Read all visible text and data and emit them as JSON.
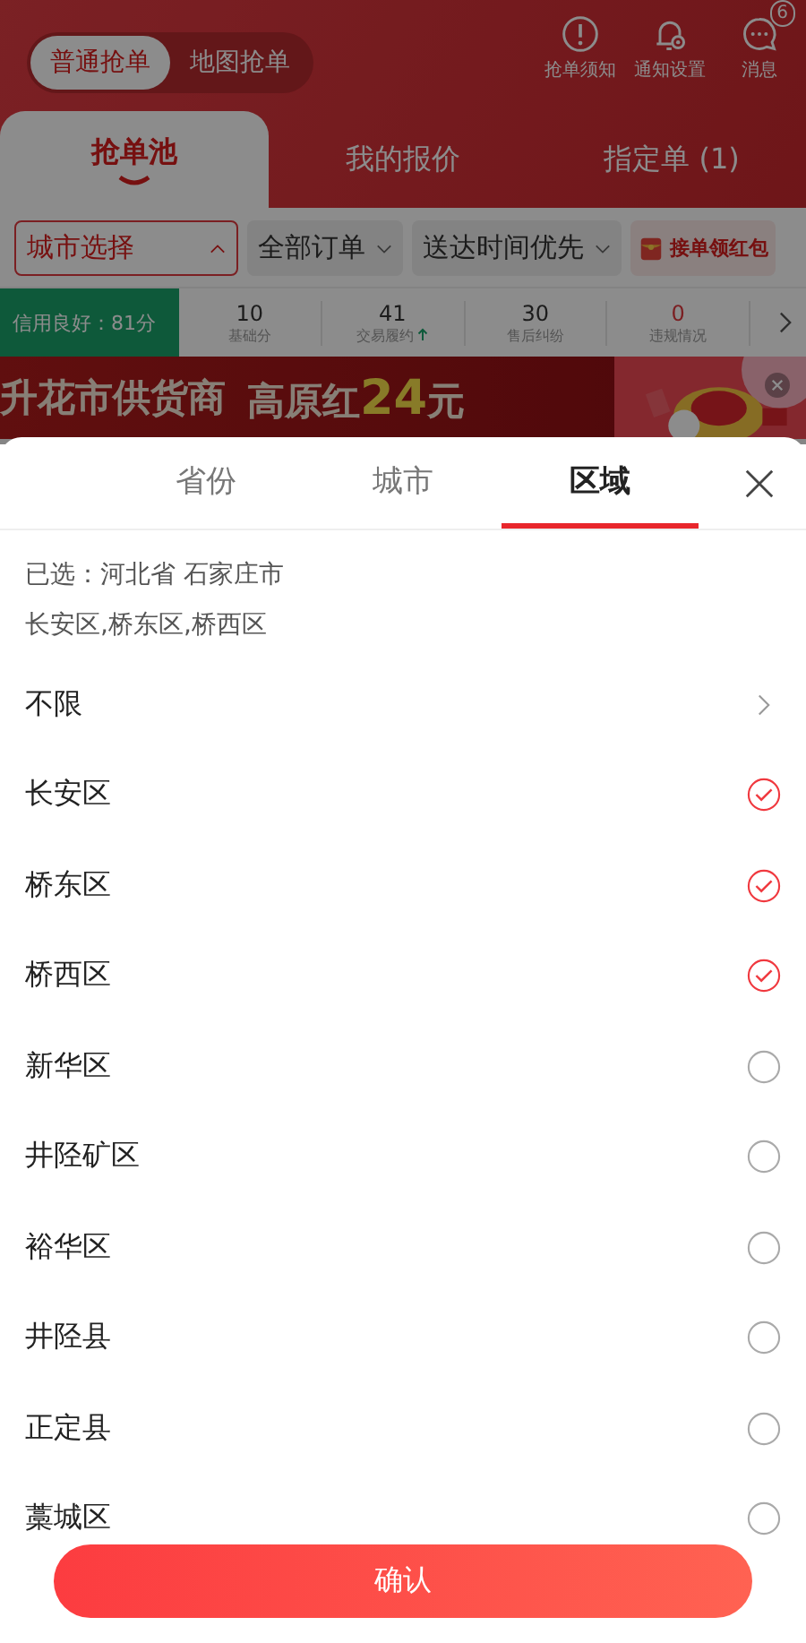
{
  "mode_tabs": [
    {
      "label": "普通抢单",
      "selected": true
    },
    {
      "label": "地图抢单",
      "selected": false
    }
  ],
  "actions": [
    {
      "kind": "notice",
      "label": "抢单须知"
    },
    {
      "kind": "settings",
      "label": "通知设置"
    },
    {
      "kind": "message",
      "label": "消息",
      "badge": "6"
    }
  ],
  "main_tabs": [
    {
      "label": "抢单池",
      "selected": true
    },
    {
      "label": "我的报价",
      "selected": false
    },
    {
      "label": "指定单 (1)",
      "selected": false
    }
  ],
  "filters": {
    "city_select": "城市选择",
    "dropdowns": [
      "全部订单",
      "送达时间优先"
    ],
    "promo": "接单领红包"
  },
  "credit": {
    "label": "信用良好：81分",
    "stats": [
      {
        "value": "10",
        "label": "基础分",
        "alert": false,
        "trend_up": false
      },
      {
        "value": "41",
        "label": "交易履约",
        "alert": false,
        "trend_up": true
      },
      {
        "value": "30",
        "label": "售后纠纷",
        "alert": false,
        "trend_up": false
      },
      {
        "value": "0",
        "label": "违规情况",
        "alert": true,
        "trend_up": false
      }
    ]
  },
  "banner": {
    "title": "升花市供货商",
    "price_prefix": "高原红",
    "price": "24",
    "unit": "元"
  },
  "sheet": {
    "tabs": [
      {
        "label": "省份",
        "selected": false
      },
      {
        "label": "城市",
        "selected": false
      },
      {
        "label": "区域",
        "selected": true
      }
    ],
    "selected_summary": "已选：河北省 石家庄市",
    "selected_districts": "长安区,桥东区,桥西区",
    "options": [
      {
        "label": "不限",
        "kind": "all"
      },
      {
        "label": "长安区",
        "kind": "option",
        "checked": true
      },
      {
        "label": "桥东区",
        "kind": "option",
        "checked": true
      },
      {
        "label": "桥西区",
        "kind": "option",
        "checked": true
      },
      {
        "label": "新华区",
        "kind": "option",
        "checked": false
      },
      {
        "label": "井陉矿区",
        "kind": "option",
        "checked": false
      },
      {
        "label": "裕华区",
        "kind": "option",
        "checked": false
      },
      {
        "label": "井陉县",
        "kind": "option",
        "checked": false
      },
      {
        "label": "正定县",
        "kind": "option",
        "checked": false
      },
      {
        "label": "藁城区",
        "kind": "option",
        "checked": false
      }
    ],
    "confirm": "确认"
  }
}
